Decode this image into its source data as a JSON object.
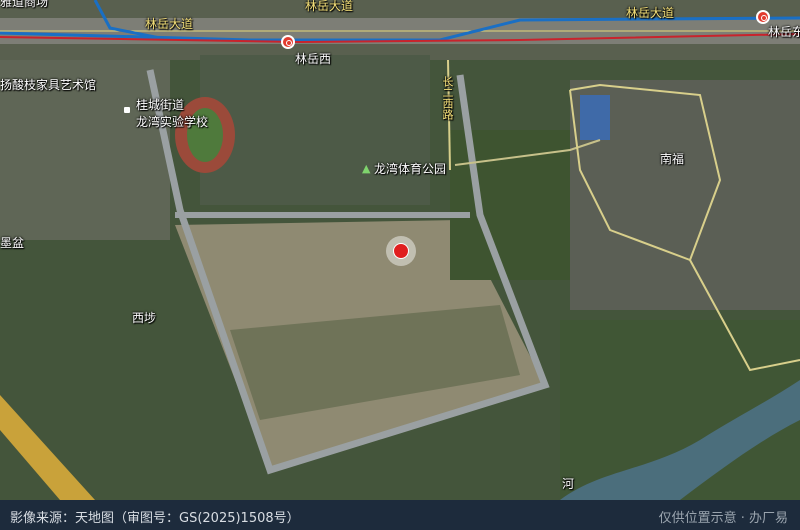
{
  "map": {
    "road_labels": [
      "林岳大道",
      "林岳大道",
      "林岳大道",
      "长二西路"
    ],
    "stations": [
      "林岳西",
      "林岳东"
    ],
    "places": {
      "top_left_partial": "雅道商场",
      "museum": "扬酸枝家具艺术馆",
      "subdistrict": "桂城街道",
      "school": "龙湾实验学校",
      "park": "龙湾体育公园",
      "village_nanfu": "南福",
      "village_xibu": "西埗",
      "left_partial": "墨盆",
      "river_partial": "河"
    },
    "icons": [
      "metro-station-icon",
      "poi-marker-icon",
      "park-tree-icon",
      "location-pin-icon"
    ],
    "colors": {
      "pin": "#e01f1f",
      "metro_line_red": "#c8232c",
      "metro_line_blue": "#1a6fc4",
      "road_label": "#f6e27a"
    }
  },
  "footer": {
    "source": "影像来源：天地图（审图号：GS(2025)1508号）",
    "note": "仅供位置示意 · 办厂易"
  }
}
